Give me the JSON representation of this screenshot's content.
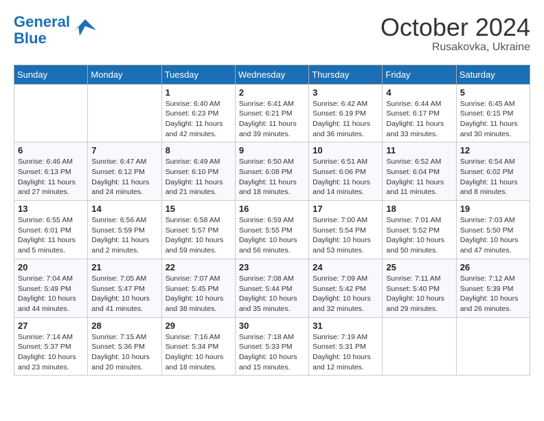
{
  "header": {
    "logo_line1": "General",
    "logo_line2": "Blue",
    "month_title": "October 2024",
    "location": "Rusakovka, Ukraine"
  },
  "weekdays": [
    "Sunday",
    "Monday",
    "Tuesday",
    "Wednesday",
    "Thursday",
    "Friday",
    "Saturday"
  ],
  "weeks": [
    [
      {
        "day": "",
        "info": ""
      },
      {
        "day": "",
        "info": ""
      },
      {
        "day": "1",
        "info": "Sunrise: 6:40 AM\nSunset: 6:23 PM\nDaylight: 11 hours and 42 minutes."
      },
      {
        "day": "2",
        "info": "Sunrise: 6:41 AM\nSunset: 6:21 PM\nDaylight: 11 hours and 39 minutes."
      },
      {
        "day": "3",
        "info": "Sunrise: 6:42 AM\nSunset: 6:19 PM\nDaylight: 11 hours and 36 minutes."
      },
      {
        "day": "4",
        "info": "Sunrise: 6:44 AM\nSunset: 6:17 PM\nDaylight: 11 hours and 33 minutes."
      },
      {
        "day": "5",
        "info": "Sunrise: 6:45 AM\nSunset: 6:15 PM\nDaylight: 11 hours and 30 minutes."
      }
    ],
    [
      {
        "day": "6",
        "info": "Sunrise: 6:46 AM\nSunset: 6:13 PM\nDaylight: 11 hours and 27 minutes."
      },
      {
        "day": "7",
        "info": "Sunrise: 6:47 AM\nSunset: 6:12 PM\nDaylight: 11 hours and 24 minutes."
      },
      {
        "day": "8",
        "info": "Sunrise: 6:49 AM\nSunset: 6:10 PM\nDaylight: 11 hours and 21 minutes."
      },
      {
        "day": "9",
        "info": "Sunrise: 6:50 AM\nSunset: 6:08 PM\nDaylight: 11 hours and 18 minutes."
      },
      {
        "day": "10",
        "info": "Sunrise: 6:51 AM\nSunset: 6:06 PM\nDaylight: 11 hours and 14 minutes."
      },
      {
        "day": "11",
        "info": "Sunrise: 6:52 AM\nSunset: 6:04 PM\nDaylight: 11 hours and 11 minutes."
      },
      {
        "day": "12",
        "info": "Sunrise: 6:54 AM\nSunset: 6:02 PM\nDaylight: 11 hours and 8 minutes."
      }
    ],
    [
      {
        "day": "13",
        "info": "Sunrise: 6:55 AM\nSunset: 6:01 PM\nDaylight: 11 hours and 5 minutes."
      },
      {
        "day": "14",
        "info": "Sunrise: 6:56 AM\nSunset: 5:59 PM\nDaylight: 11 hours and 2 minutes."
      },
      {
        "day": "15",
        "info": "Sunrise: 6:58 AM\nSunset: 5:57 PM\nDaylight: 10 hours and 59 minutes."
      },
      {
        "day": "16",
        "info": "Sunrise: 6:59 AM\nSunset: 5:55 PM\nDaylight: 10 hours and 56 minutes."
      },
      {
        "day": "17",
        "info": "Sunrise: 7:00 AM\nSunset: 5:54 PM\nDaylight: 10 hours and 53 minutes."
      },
      {
        "day": "18",
        "info": "Sunrise: 7:01 AM\nSunset: 5:52 PM\nDaylight: 10 hours and 50 minutes."
      },
      {
        "day": "19",
        "info": "Sunrise: 7:03 AM\nSunset: 5:50 PM\nDaylight: 10 hours and 47 minutes."
      }
    ],
    [
      {
        "day": "20",
        "info": "Sunrise: 7:04 AM\nSunset: 5:49 PM\nDaylight: 10 hours and 44 minutes."
      },
      {
        "day": "21",
        "info": "Sunrise: 7:05 AM\nSunset: 5:47 PM\nDaylight: 10 hours and 41 minutes."
      },
      {
        "day": "22",
        "info": "Sunrise: 7:07 AM\nSunset: 5:45 PM\nDaylight: 10 hours and 38 minutes."
      },
      {
        "day": "23",
        "info": "Sunrise: 7:08 AM\nSunset: 5:44 PM\nDaylight: 10 hours and 35 minutes."
      },
      {
        "day": "24",
        "info": "Sunrise: 7:09 AM\nSunset: 5:42 PM\nDaylight: 10 hours and 32 minutes."
      },
      {
        "day": "25",
        "info": "Sunrise: 7:11 AM\nSunset: 5:40 PM\nDaylight: 10 hours and 29 minutes."
      },
      {
        "day": "26",
        "info": "Sunrise: 7:12 AM\nSunset: 5:39 PM\nDaylight: 10 hours and 26 minutes."
      }
    ],
    [
      {
        "day": "27",
        "info": "Sunrise: 7:14 AM\nSunset: 5:37 PM\nDaylight: 10 hours and 23 minutes."
      },
      {
        "day": "28",
        "info": "Sunrise: 7:15 AM\nSunset: 5:36 PM\nDaylight: 10 hours and 20 minutes."
      },
      {
        "day": "29",
        "info": "Sunrise: 7:16 AM\nSunset: 5:34 PM\nDaylight: 10 hours and 18 minutes."
      },
      {
        "day": "30",
        "info": "Sunrise: 7:18 AM\nSunset: 5:33 PM\nDaylight: 10 hours and 15 minutes."
      },
      {
        "day": "31",
        "info": "Sunrise: 7:19 AM\nSunset: 5:31 PM\nDaylight: 10 hours and 12 minutes."
      },
      {
        "day": "",
        "info": ""
      },
      {
        "day": "",
        "info": ""
      }
    ]
  ]
}
